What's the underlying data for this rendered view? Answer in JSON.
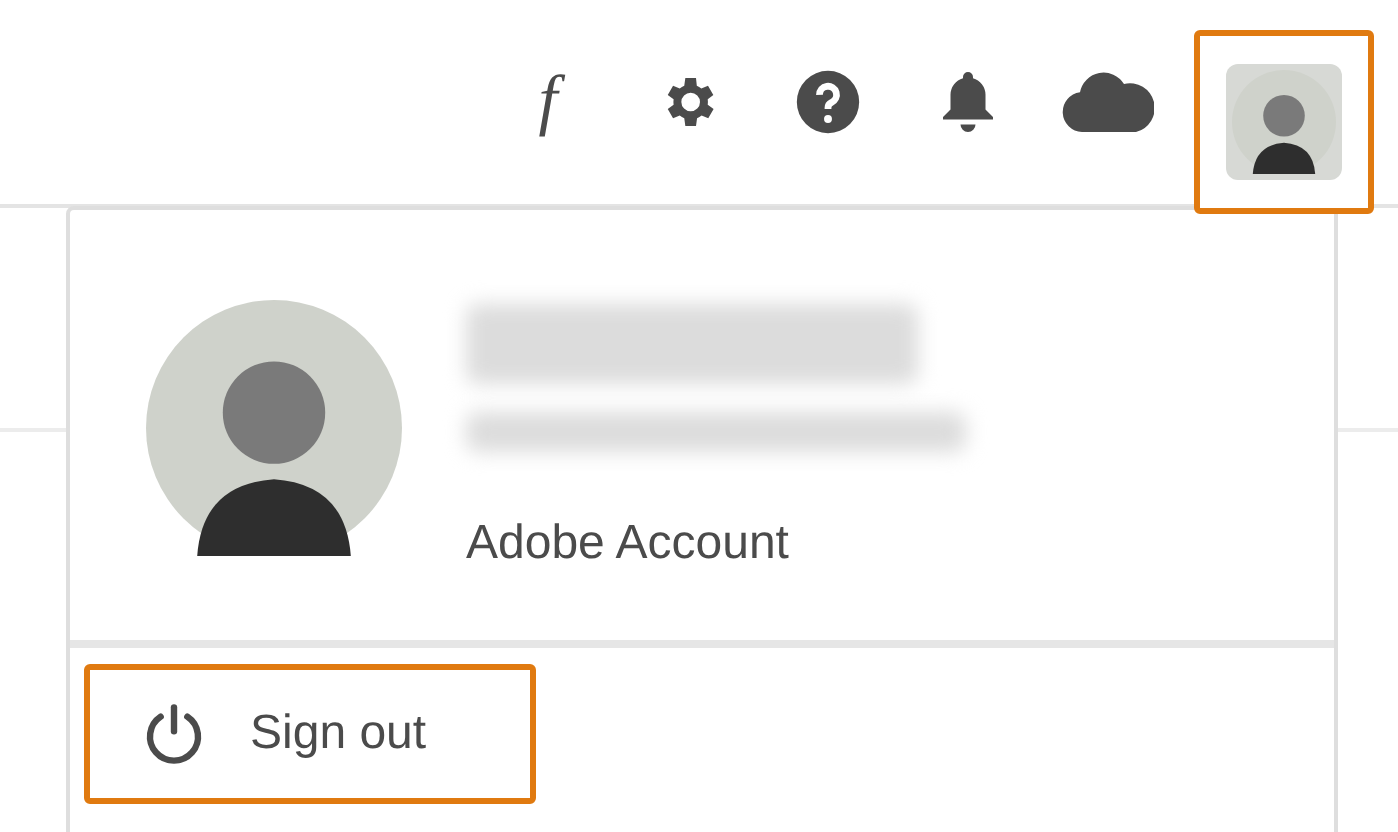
{
  "header": {
    "icons": [
      {
        "kind": "glyph",
        "text": "f"
      },
      {
        "kind": "gear"
      },
      {
        "kind": "help"
      },
      {
        "kind": "bell"
      },
      {
        "kind": "cloud"
      }
    ],
    "avatar_button": {
      "highlighted": true
    }
  },
  "account_menu": {
    "account_link": "Adobe Account",
    "sign_out": {
      "label": "Sign out",
      "highlighted": true
    }
  }
}
